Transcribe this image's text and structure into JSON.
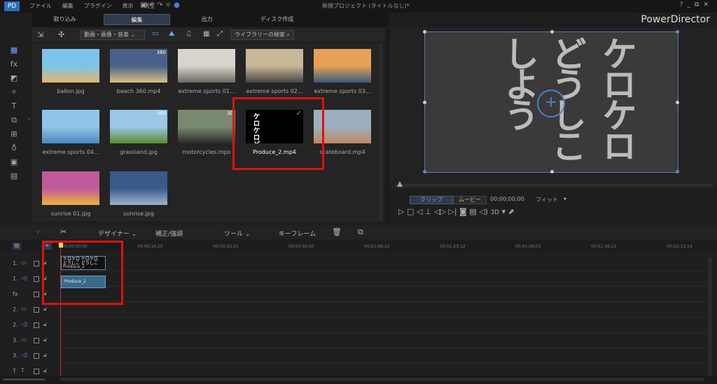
{
  "app": {
    "brand": "PowerDirector",
    "project_title": "新規プロジェクト (タイトルなし)*"
  },
  "menu": [
    "ファイル",
    "編集",
    "プラグイン",
    "表示",
    "再生"
  ],
  "window_controls": [
    "?",
    "_",
    "⧉",
    "✕"
  ],
  "mode_tabs": [
    {
      "label": "取り込み"
    },
    {
      "label": "編集"
    },
    {
      "label": "出力"
    },
    {
      "label": "ディスク作成"
    }
  ],
  "library": {
    "filter": "動画・画像・音楽",
    "search_label": "ライブラリーの検索"
  },
  "media": [
    {
      "name": "ballon.jpg",
      "colors": [
        "#7cc5e8",
        "#e5b46a"
      ]
    },
    {
      "name": "beach 360.mp4",
      "badge": "360",
      "colors": [
        "#49618a",
        "#d9c08a"
      ]
    },
    {
      "name": "extreme sports 01...",
      "colors": [
        "#d8d4cc",
        "#6e6a60"
      ]
    },
    {
      "name": "extreme sports 02...",
      "colors": [
        "#c9b79a",
        "#4b4640"
      ]
    },
    {
      "name": "extreme sports 03...",
      "colors": [
        "#e5a15a",
        "#3a5a7a"
      ]
    },
    {
      "name": "extreme sports 04...",
      "colors": [
        "#8ec5e8",
        "#4f87c0"
      ]
    },
    {
      "name": "grassland.jpg",
      "badge": "360",
      "colors": [
        "#9ac8e6",
        "#5a8a30"
      ]
    },
    {
      "name": "motorcycles.mpo",
      "badge": "3D",
      "colors": [
        "#7a8a70",
        "#2a2a2a"
      ]
    },
    {
      "name": "Produce_2.mp4",
      "colors": [
        "#000000",
        "#ffffff"
      ]
    },
    {
      "name": "skateboard.mp4",
      "colors": [
        "#9ab0c0",
        "#c08860"
      ]
    },
    {
      "name": "sunrise 01.jpg",
      "colors": [
        "#c05a9a",
        "#f0b040"
      ]
    },
    {
      "name": "sunrise.jpg",
      "colors": [
        "#3a5a8a",
        "#9ab4d0"
      ]
    }
  ],
  "preview": {
    "tab_clip": "クリップ",
    "tab_movie": "ムービー",
    "timecode": "00;00;00;00",
    "fit": "フィット",
    "mode_3d": "3D",
    "text_lines": [
      "ケロケロ",
      "どうしこ",
      "しよう"
    ]
  },
  "timeline_toolbar": {
    "designer": "デザイナー",
    "correct": "補正/強調",
    "tools": "ツール",
    "keyframe": "キーフレーム"
  },
  "ruler": [
    "00;00;00;00",
    "00;00;16;20",
    "00;00;33;10",
    "00;00;50;00",
    "00;01;06;22",
    "00;01;23;12",
    "00;01;40;02",
    "00;01;56;22",
    "00;02;13;14"
  ],
  "tracks": [
    {
      "num": "1.",
      "kind": "video"
    },
    {
      "num": "1.",
      "kind": "audio"
    },
    {
      "num": "fx",
      "kind": "fx"
    },
    {
      "num": "2.",
      "kind": "video"
    },
    {
      "num": "2.",
      "kind": "audio"
    },
    {
      "num": "3.",
      "kind": "video"
    },
    {
      "num": "3.",
      "kind": "audio"
    },
    {
      "num": "T",
      "kind": "title"
    }
  ],
  "clips": {
    "video_label": "Produce_2",
    "audio_label": "Produce_2"
  }
}
